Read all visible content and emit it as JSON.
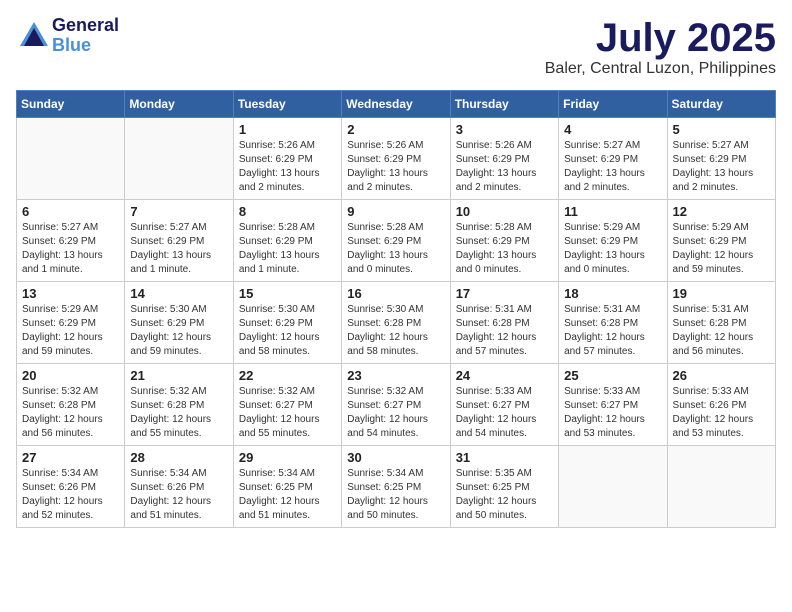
{
  "logo": {
    "general": "General",
    "blue": "Blue"
  },
  "title": {
    "month": "July 2025",
    "location": "Baler, Central Luzon, Philippines"
  },
  "weekdays": [
    "Sunday",
    "Monday",
    "Tuesday",
    "Wednesday",
    "Thursday",
    "Friday",
    "Saturday"
  ],
  "weeks": [
    [
      {
        "day": "",
        "info": ""
      },
      {
        "day": "",
        "info": ""
      },
      {
        "day": "1",
        "info": "Sunrise: 5:26 AM\nSunset: 6:29 PM\nDaylight: 13 hours and 2 minutes."
      },
      {
        "day": "2",
        "info": "Sunrise: 5:26 AM\nSunset: 6:29 PM\nDaylight: 13 hours and 2 minutes."
      },
      {
        "day": "3",
        "info": "Sunrise: 5:26 AM\nSunset: 6:29 PM\nDaylight: 13 hours and 2 minutes."
      },
      {
        "day": "4",
        "info": "Sunrise: 5:27 AM\nSunset: 6:29 PM\nDaylight: 13 hours and 2 minutes."
      },
      {
        "day": "5",
        "info": "Sunrise: 5:27 AM\nSunset: 6:29 PM\nDaylight: 13 hours and 2 minutes."
      }
    ],
    [
      {
        "day": "6",
        "info": "Sunrise: 5:27 AM\nSunset: 6:29 PM\nDaylight: 13 hours and 1 minute."
      },
      {
        "day": "7",
        "info": "Sunrise: 5:27 AM\nSunset: 6:29 PM\nDaylight: 13 hours and 1 minute."
      },
      {
        "day": "8",
        "info": "Sunrise: 5:28 AM\nSunset: 6:29 PM\nDaylight: 13 hours and 1 minute."
      },
      {
        "day": "9",
        "info": "Sunrise: 5:28 AM\nSunset: 6:29 PM\nDaylight: 13 hours and 0 minutes."
      },
      {
        "day": "10",
        "info": "Sunrise: 5:28 AM\nSunset: 6:29 PM\nDaylight: 13 hours and 0 minutes."
      },
      {
        "day": "11",
        "info": "Sunrise: 5:29 AM\nSunset: 6:29 PM\nDaylight: 13 hours and 0 minutes."
      },
      {
        "day": "12",
        "info": "Sunrise: 5:29 AM\nSunset: 6:29 PM\nDaylight: 12 hours and 59 minutes."
      }
    ],
    [
      {
        "day": "13",
        "info": "Sunrise: 5:29 AM\nSunset: 6:29 PM\nDaylight: 12 hours and 59 minutes."
      },
      {
        "day": "14",
        "info": "Sunrise: 5:30 AM\nSunset: 6:29 PM\nDaylight: 12 hours and 59 minutes."
      },
      {
        "day": "15",
        "info": "Sunrise: 5:30 AM\nSunset: 6:29 PM\nDaylight: 12 hours and 58 minutes."
      },
      {
        "day": "16",
        "info": "Sunrise: 5:30 AM\nSunset: 6:28 PM\nDaylight: 12 hours and 58 minutes."
      },
      {
        "day": "17",
        "info": "Sunrise: 5:31 AM\nSunset: 6:28 PM\nDaylight: 12 hours and 57 minutes."
      },
      {
        "day": "18",
        "info": "Sunrise: 5:31 AM\nSunset: 6:28 PM\nDaylight: 12 hours and 57 minutes."
      },
      {
        "day": "19",
        "info": "Sunrise: 5:31 AM\nSunset: 6:28 PM\nDaylight: 12 hours and 56 minutes."
      }
    ],
    [
      {
        "day": "20",
        "info": "Sunrise: 5:32 AM\nSunset: 6:28 PM\nDaylight: 12 hours and 56 minutes."
      },
      {
        "day": "21",
        "info": "Sunrise: 5:32 AM\nSunset: 6:28 PM\nDaylight: 12 hours and 55 minutes."
      },
      {
        "day": "22",
        "info": "Sunrise: 5:32 AM\nSunset: 6:27 PM\nDaylight: 12 hours and 55 minutes."
      },
      {
        "day": "23",
        "info": "Sunrise: 5:32 AM\nSunset: 6:27 PM\nDaylight: 12 hours and 54 minutes."
      },
      {
        "day": "24",
        "info": "Sunrise: 5:33 AM\nSunset: 6:27 PM\nDaylight: 12 hours and 54 minutes."
      },
      {
        "day": "25",
        "info": "Sunrise: 5:33 AM\nSunset: 6:27 PM\nDaylight: 12 hours and 53 minutes."
      },
      {
        "day": "26",
        "info": "Sunrise: 5:33 AM\nSunset: 6:26 PM\nDaylight: 12 hours and 53 minutes."
      }
    ],
    [
      {
        "day": "27",
        "info": "Sunrise: 5:34 AM\nSunset: 6:26 PM\nDaylight: 12 hours and 52 minutes."
      },
      {
        "day": "28",
        "info": "Sunrise: 5:34 AM\nSunset: 6:26 PM\nDaylight: 12 hours and 51 minutes."
      },
      {
        "day": "29",
        "info": "Sunrise: 5:34 AM\nSunset: 6:25 PM\nDaylight: 12 hours and 51 minutes."
      },
      {
        "day": "30",
        "info": "Sunrise: 5:34 AM\nSunset: 6:25 PM\nDaylight: 12 hours and 50 minutes."
      },
      {
        "day": "31",
        "info": "Sunrise: 5:35 AM\nSunset: 6:25 PM\nDaylight: 12 hours and 50 minutes."
      },
      {
        "day": "",
        "info": ""
      },
      {
        "day": "",
        "info": ""
      }
    ]
  ]
}
